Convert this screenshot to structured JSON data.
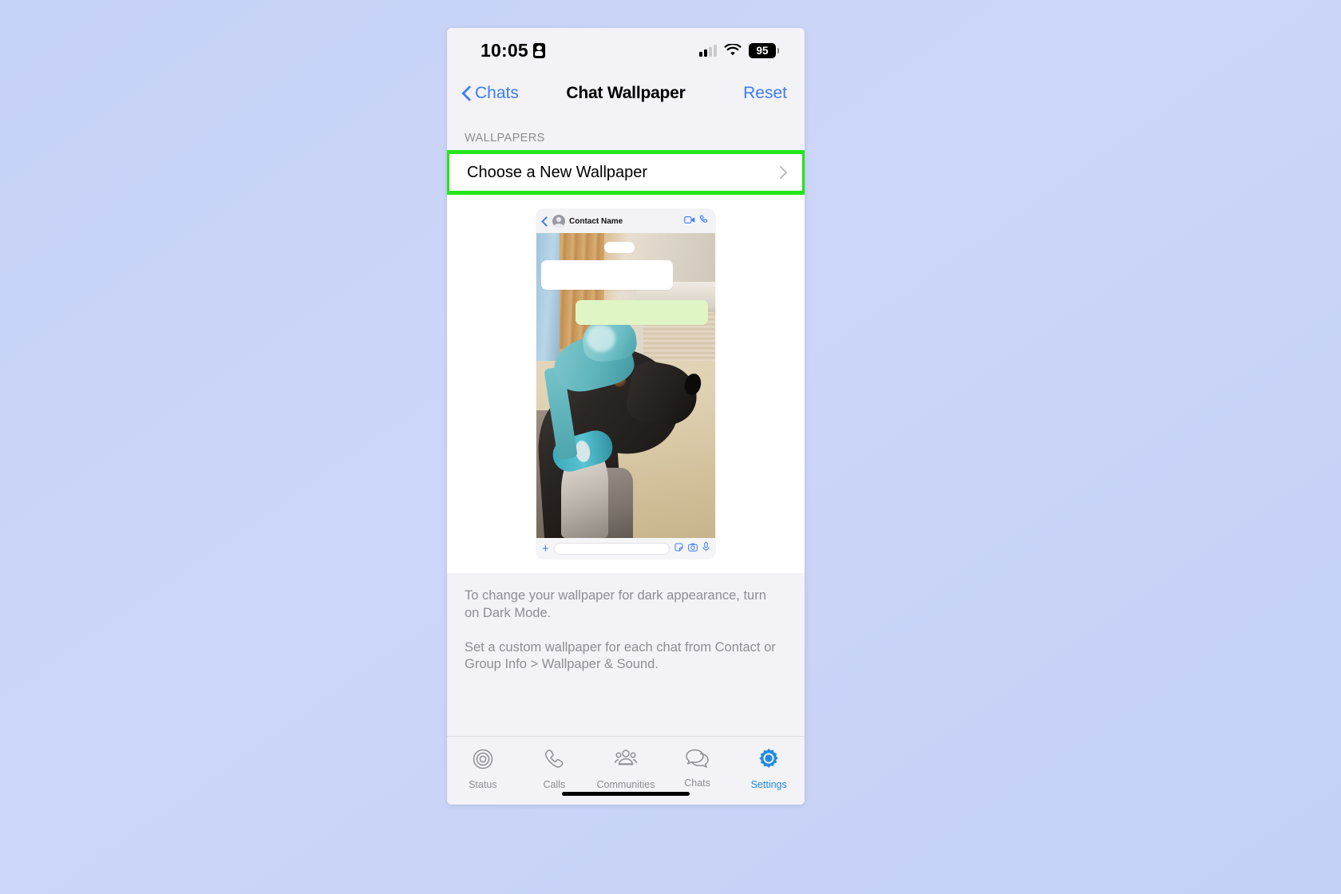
{
  "status_bar": {
    "time": "10:05",
    "recording_icon": "screen-record-icon",
    "signal_icon": "cellular-signal-icon",
    "wifi_icon": "wifi-icon",
    "battery_percent": "95"
  },
  "nav": {
    "back_label": "Chats",
    "back_icon": "chevron-left-icon",
    "title": "Chat Wallpaper",
    "reset_label": "Reset"
  },
  "section": {
    "label": "WALLPAPERS"
  },
  "choose_row": {
    "label": "Choose a New Wallpaper",
    "chevron_icon": "chevron-right-icon",
    "highlight_color": "#22e619"
  },
  "preview": {
    "back_icon": "chevron-left-icon",
    "avatar_icon": "contact-avatar-icon",
    "contact_name": "Contact Name",
    "video_call_icon": "video-camera-icon",
    "voice_call_icon": "phone-icon",
    "wallpaper_description": "Photo of a black greyhound wearing a teal sun visor cap, indoors on a carpeted floor",
    "input_plus_icon": "plus-icon",
    "sticker_icon": "sticker-icon",
    "camera_icon": "camera-icon",
    "mic_icon": "microphone-icon"
  },
  "footer": {
    "paragraph_1": "To change your wallpaper for dark appearance, turn on Dark Mode.",
    "paragraph_2": "Set a custom wallpaper for each chat from Contact or Group Info > Wallpaper & Sound."
  },
  "tabbar": {
    "active_color": "#1f8ae0",
    "inactive_color": "#8d8d93",
    "items": [
      {
        "label": "Status",
        "icon": "status-rings-icon",
        "active": false
      },
      {
        "label": "Calls",
        "icon": "phone-icon",
        "active": false
      },
      {
        "label": "Communities",
        "icon": "communities-icon",
        "active": false
      },
      {
        "label": "Chats",
        "icon": "chat-bubbles-icon",
        "active": false
      },
      {
        "label": "Settings",
        "icon": "gear-icon",
        "active": true
      }
    ]
  }
}
